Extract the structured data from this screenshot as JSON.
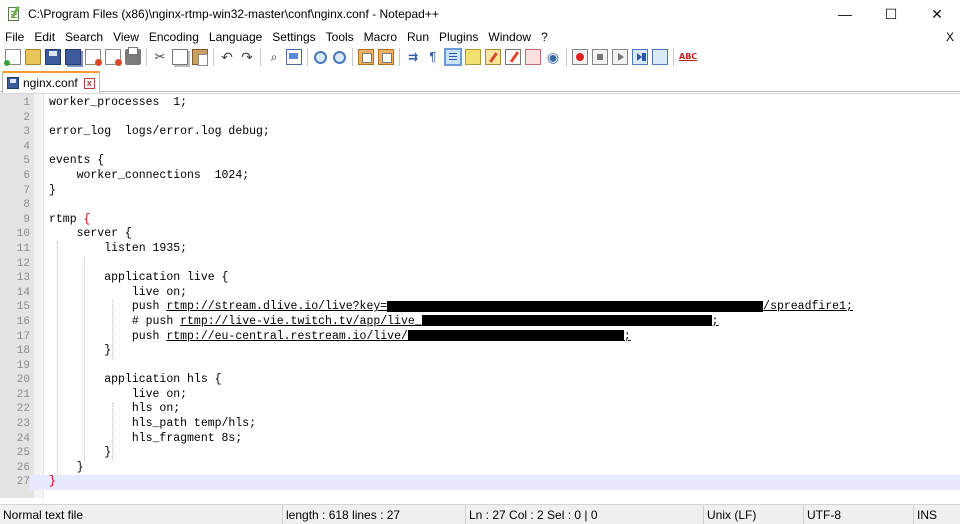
{
  "window": {
    "title": "C:\\Program Files (x86)\\nginx-rtmp-win32-master\\conf\\nginx.conf - Notepad++",
    "minimize": "—",
    "maximize": "☐",
    "close": "✕"
  },
  "menu": {
    "file": "File",
    "edit": "Edit",
    "search": "Search",
    "view": "View",
    "encoding": "Encoding",
    "language": "Language",
    "settings": "Settings",
    "tools": "Tools",
    "macro": "Macro",
    "run": "Run",
    "plugins": "Plugins",
    "window": "Window",
    "help": "?",
    "close_doc": "X"
  },
  "tab": {
    "label": "nginx.conf",
    "close": "x"
  },
  "editor": {
    "lines": [
      {
        "n": "1",
        "text": "worker_processes  1;"
      },
      {
        "n": "2",
        "text": ""
      },
      {
        "n": "3",
        "text": "error_log  logs/error.log debug;"
      },
      {
        "n": "4",
        "text": ""
      },
      {
        "n": "5",
        "text": "events {"
      },
      {
        "n": "6",
        "text": "    worker_connections  1024;"
      },
      {
        "n": "7",
        "text": "}"
      },
      {
        "n": "8",
        "text": ""
      },
      {
        "n": "9",
        "text": "rtmp "
      },
      {
        "n": "10",
        "text": "    server {"
      },
      {
        "n": "11",
        "text": "        listen 1935;"
      },
      {
        "n": "12",
        "text": ""
      },
      {
        "n": "13",
        "text": "        application live {"
      },
      {
        "n": "14",
        "text": "            live on;"
      },
      {
        "n": "15",
        "pre": "            push ",
        "url": "rtmp://stream.dlive.io/live?key=",
        "post": "/spreadfire1;"
      },
      {
        "n": "16",
        "pre": "            # push ",
        "url": "rtmp://live-vie.twitch.tv/app/live_",
        "post": ";"
      },
      {
        "n": "17",
        "pre": "            push ",
        "url": "rtmp://eu-central.restream.io/live/",
        "post": ";"
      },
      {
        "n": "18",
        "text": "        }"
      },
      {
        "n": "19",
        "text": ""
      },
      {
        "n": "20",
        "text": "        application hls {"
      },
      {
        "n": "21",
        "text": "            live on;"
      },
      {
        "n": "22",
        "text": "            hls on;"
      },
      {
        "n": "23",
        "text": "            hls_path temp/hls;"
      },
      {
        "n": "24",
        "text": "            hls_fragment 8s;"
      },
      {
        "n": "25",
        "text": "        }"
      },
      {
        "n": "26",
        "text": "    }"
      },
      {
        "n": "27",
        "text": ""
      }
    ],
    "brace_open": "{",
    "brace_close": "}"
  },
  "status": {
    "file_type": "Normal text file",
    "length_lines": "length : 618    lines : 27",
    "cursor": "Ln : 27    Col : 2    Sel : 0 | 0",
    "eol": "Unix (LF)",
    "encoding": "UTF-8",
    "mode": "INS"
  }
}
